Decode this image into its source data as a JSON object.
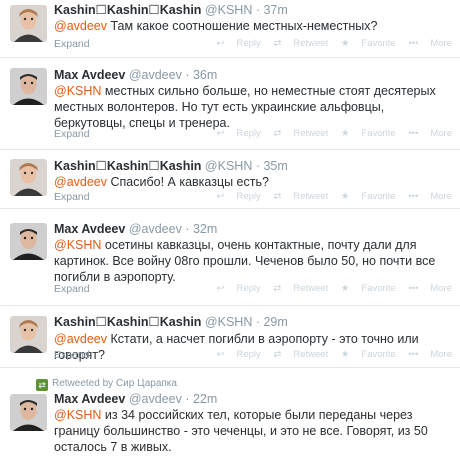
{
  "tweets": [
    {
      "name": "Kashin☐Kashin☐Kashin",
      "handle": "@KSHN",
      "dot": "·",
      "time": "37m",
      "mention": "@avdeev",
      "text": " Там какое соотношение местных-неместных?",
      "expand": "Expand",
      "avatar": "kashin"
    },
    {
      "name": "Max Avdeev",
      "handle": "@avdeev",
      "dot": "·",
      "time": "36m",
      "mention": "@KSHN",
      "text": " местных сильно больше, но неместные стоят десятерых местных волонтеров. Но тут есть украинские альфовцы, беркутовцы, спецы и тренера.",
      "expand": "Expand",
      "avatar": "avdeev"
    },
    {
      "name": "Kashin☐Kashin☐Kashin",
      "handle": "@KSHN",
      "dot": "·",
      "time": "35m",
      "mention": "@avdeev",
      "text": " Спасибо! А кавказцы есть?",
      "expand": "Expand",
      "avatar": "kashin"
    },
    {
      "name": "Max Avdeev",
      "handle": "@avdeev",
      "dot": "·",
      "time": "32m",
      "mention": "@KSHN",
      "text": " осетины кавказцы, очень контактные, почту дали для картинок. Все войну 08го прошли. Чеченов было 50, но почти все погибли в аэропорту.",
      "expand": "Expand",
      "avatar": "avdeev"
    },
    {
      "name": "Kashin☐Kashin☐Kashin",
      "handle": "@KSHN",
      "dot": "·",
      "time": "29m",
      "mention": "@avdeev",
      "text": " Кстати, а насчет погибли в аэропорту - это точно или говорят?",
      "expand": "Expand",
      "avatar": "kashin"
    },
    {
      "name": "Max Avdeev",
      "handle": "@avdeev",
      "dot": "·",
      "time": "22m",
      "mention": "@KSHN",
      "text": " из 34 российских тел, которые были переданы через границу большинство - это чеченцы, и это не все. Говорят, из 50 осталось 7 в живых.",
      "expand": "",
      "avatar": "avdeev"
    }
  ],
  "actions": {
    "reply": "Reply",
    "retweet": "Retweet",
    "favorite": "Favorite",
    "more": "More"
  },
  "retweet_context": {
    "text": "Retweeted by Сир Царапка",
    "icon": "retweet-icon"
  },
  "colors": {
    "mention": "#e25c14",
    "meta": "#8899a6",
    "action": "#ccd6dd"
  }
}
